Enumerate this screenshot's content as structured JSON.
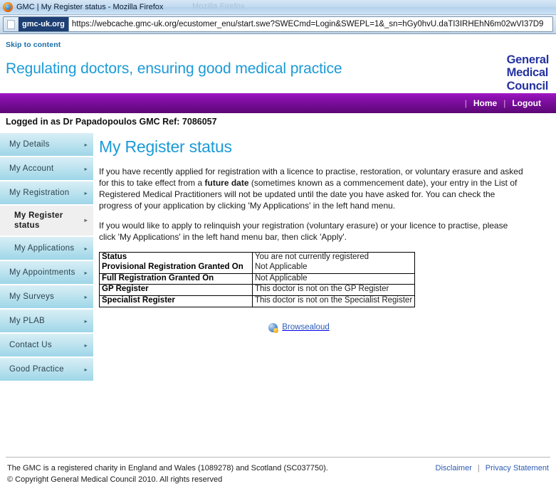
{
  "browser": {
    "window_title": "GMC | My Register status - Mozilla Firefox",
    "title_ghost": "Mozilla Firefox",
    "ev_badge": "gmc-uk.org",
    "url": "https://webcache.gmc-uk.org/ecustomer_enu/start.swe?SWECmd=Login&SWEPL=1&_sn=hGy0hvU.daTI3IRHEhN6m02wVI37D9"
  },
  "header": {
    "skip_link": "Skip to content",
    "tagline": "Regulating doctors, ensuring good medical practice",
    "logo_line1": "General",
    "logo_line2": "Medical",
    "logo_line3": "Council"
  },
  "topnav": {
    "separator": "|",
    "home": "Home",
    "logout": "Logout"
  },
  "session": {
    "logged_in_as": "Logged in as Dr Papadopoulos GMC Ref: 7086057"
  },
  "sidebar": {
    "arrow_glyph": "▸",
    "items": [
      {
        "label": "My Details",
        "level": "top",
        "active": false
      },
      {
        "label": "My Account",
        "level": "top",
        "active": false
      },
      {
        "label": "My Registration",
        "level": "top",
        "active": false
      },
      {
        "label": "My Register status",
        "level": "sub",
        "active": true
      },
      {
        "label": "My Applications",
        "level": "sub",
        "active": false
      },
      {
        "label": "My Appointments",
        "level": "top",
        "active": false
      },
      {
        "label": "My Surveys",
        "level": "top",
        "active": false
      },
      {
        "label": "My PLAB",
        "level": "top",
        "active": false
      },
      {
        "label": "Contact Us",
        "level": "top",
        "active": false
      },
      {
        "label": "Good Practice",
        "level": "top",
        "active": false
      }
    ]
  },
  "main": {
    "title": "My Register status",
    "paragraph1_part1": "If you have recently applied for registration with a licence to practise, restoration, or voluntary erasure and asked for this to take effect from a ",
    "paragraph1_bold": "future date",
    "paragraph1_part2": " (sometimes known as a commencement date), your entry in the List of Registered Medical Practitioners will not be updated until the date you have asked for. You can check the progress of your application by clicking 'My Applications' in the left hand menu.",
    "paragraph2": "If you would like to apply to relinquish your registration (voluntary erasure) or your licence to practise, please click 'My Applications' in the left hand menu bar, then click 'Apply'.",
    "table": {
      "rows": [
        {
          "key": "Status",
          "value": "You are not currently registered",
          "top_border": false
        },
        {
          "key": "Provisional Registration Granted On",
          "value": "Not Applicable",
          "top_border": false
        },
        {
          "key": "Full Registration Granted On",
          "value": "Not Applicable",
          "top_border": true
        },
        {
          "key": "GP Register",
          "value": "This doctor is not on the GP Register",
          "top_border": true
        },
        {
          "key": "Specialist Register",
          "value": "This doctor is not on the Specialist Register",
          "top_border": true
        }
      ]
    }
  },
  "browsealoud": {
    "label": "Browsealoud"
  },
  "footer": {
    "line1": "The GMC is a registered charity in England and Wales (1089278) and Scotland (SC037750).",
    "line2": "© Copyright General Medical Council 2010. All rights reserved",
    "disclaimer": "Disclaimer",
    "separator": "|",
    "privacy": "Privacy Statement"
  },
  "colors": {
    "brand_cyan": "#1b9ad6",
    "brand_purple": "#7a0c9b",
    "logo_blue": "#2433a0",
    "link_blue": "#2b5bb5",
    "sidebar_cyan": "#9ed6e8"
  }
}
